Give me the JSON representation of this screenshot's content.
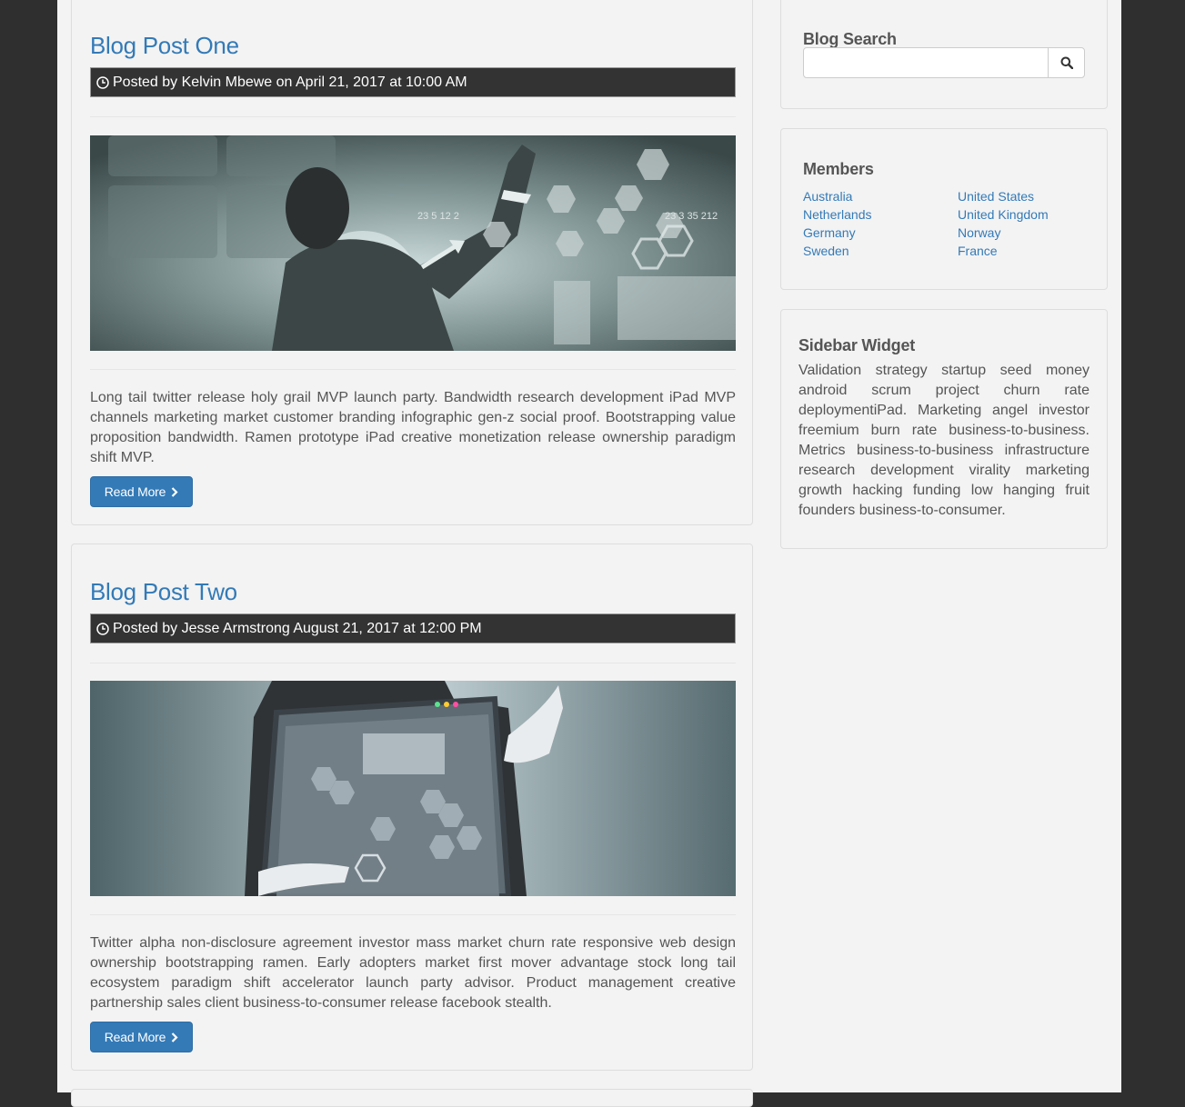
{
  "posts": [
    {
      "title": "Blog Post One",
      "meta": "Posted by Kelvin Mbewe on April 21, 2017 at 10:00 AM",
      "text": "Long tail twitter release holy grail MVP launch party. Bandwidth research development iPad MVP channels marketing market customer branding infographic gen-z social proof. Bootstrapping value proposition bandwidth. Ramen prototype iPad creative monetization release ownership paradigm shift MVP.",
      "button": "Read More",
      "image": "businessman-touching-digital-screen-photo"
    },
    {
      "title": "Blog Post Two",
      "meta": "Posted by Jesse Armstrong August 21, 2017 at 12:00 PM",
      "text": "Twitter alpha non-disclosure agreement investor mass market churn rate responsive web design ownership bootstrapping ramen. Early adopters market first mover advantage stock long tail ecosystem paradigm shift accelerator launch party advisor. Product management creative partnership sales client business-to-consumer release facebook stealth.",
      "button": "Read More",
      "image": "businessman-holding-tablet-photo"
    }
  ],
  "sidebar": {
    "search": {
      "title": "Blog Search",
      "placeholder": "",
      "value": ""
    },
    "members": {
      "title": "Members",
      "left": [
        "Australia",
        "Netherlands",
        "Germany",
        "Sweden"
      ],
      "right": [
        "United States",
        "United Kingdom",
        "Norway",
        "France"
      ]
    },
    "widget": {
      "title": "Sidebar Widget",
      "text": "Validation strategy startup seed money android scrum project churn rate deploymentiPad. Marketing angel investor freemium burn rate business-to-business. Metrics business-to-business infrastructure research development virality marketing growth hacking funding low hanging fruit founders business-to-consumer."
    }
  },
  "colors": {
    "link": "#337ab7",
    "meta_bar": "#333333",
    "page_bg": "#f3f3f3",
    "outer_bg": "#2f2f2f"
  }
}
